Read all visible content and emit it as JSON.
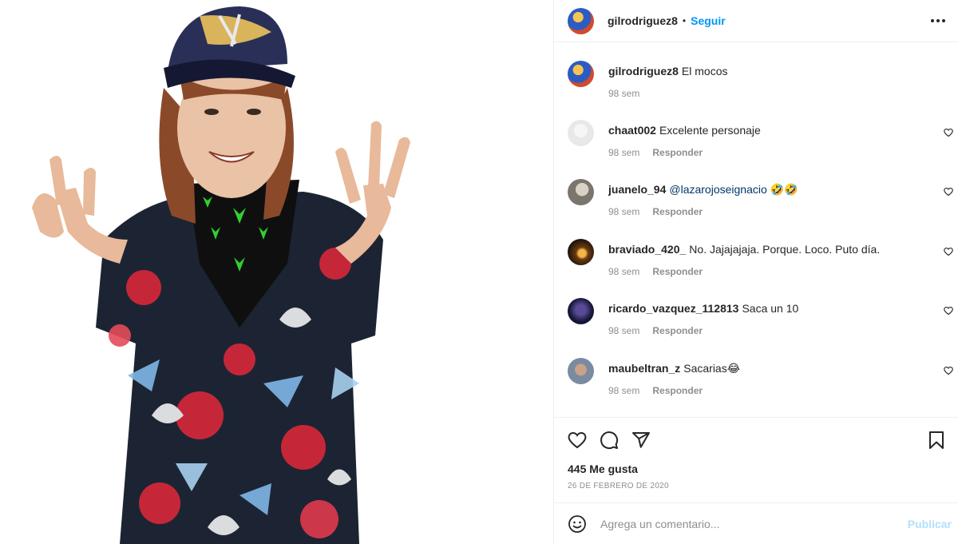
{
  "post": {
    "username": "gilrodriguez8",
    "separator": "•",
    "follow_label": "Seguir",
    "more_icon": "more-horizontal-icon"
  },
  "caption": {
    "username": "gilrodriguez8",
    "text": "El mocos",
    "time": "98 sem"
  },
  "comments": [
    {
      "username": "chaat002",
      "text": "Excelente personaje",
      "mention": "",
      "emoji": "",
      "time": "98 sem",
      "reply": "Responder"
    },
    {
      "username": "juanelo_94",
      "text": "",
      "mention": "@lazarojoseignacio",
      "emoji": "🤣🤣",
      "time": "98 sem",
      "reply": "Responder"
    },
    {
      "username": "braviado_420_",
      "text": "No. Jajajajaja. Porque. Loco. Puto día.",
      "mention": "",
      "emoji": "",
      "time": "98 sem",
      "reply": "Responder"
    },
    {
      "username": "ricardo_vazquez_112813",
      "text": "Saca un 10",
      "mention": "",
      "emoji": "",
      "time": "98 sem",
      "reply": "Responder"
    },
    {
      "username": "maubeltran_z",
      "text": "Sacarias",
      "mention": "",
      "emoji": "😂",
      "time": "98 sem",
      "reply": "Responder"
    }
  ],
  "actions": {
    "like_icon": "heart-icon",
    "comment_icon": "comment-icon",
    "share_icon": "send-icon",
    "save_icon": "bookmark-icon"
  },
  "likes_text": "445 Me gusta",
  "date_text": "26 de febrero de 2020",
  "add_comment": {
    "placeholder": "Agrega un comentario...",
    "post_label": "Publicar",
    "emoji_icon": "smiley-icon"
  },
  "colors": {
    "link_blue": "#0095f6",
    "post_disabled": "#b2dffc",
    "muted": "#8e8e8e",
    "border": "#efefef"
  }
}
